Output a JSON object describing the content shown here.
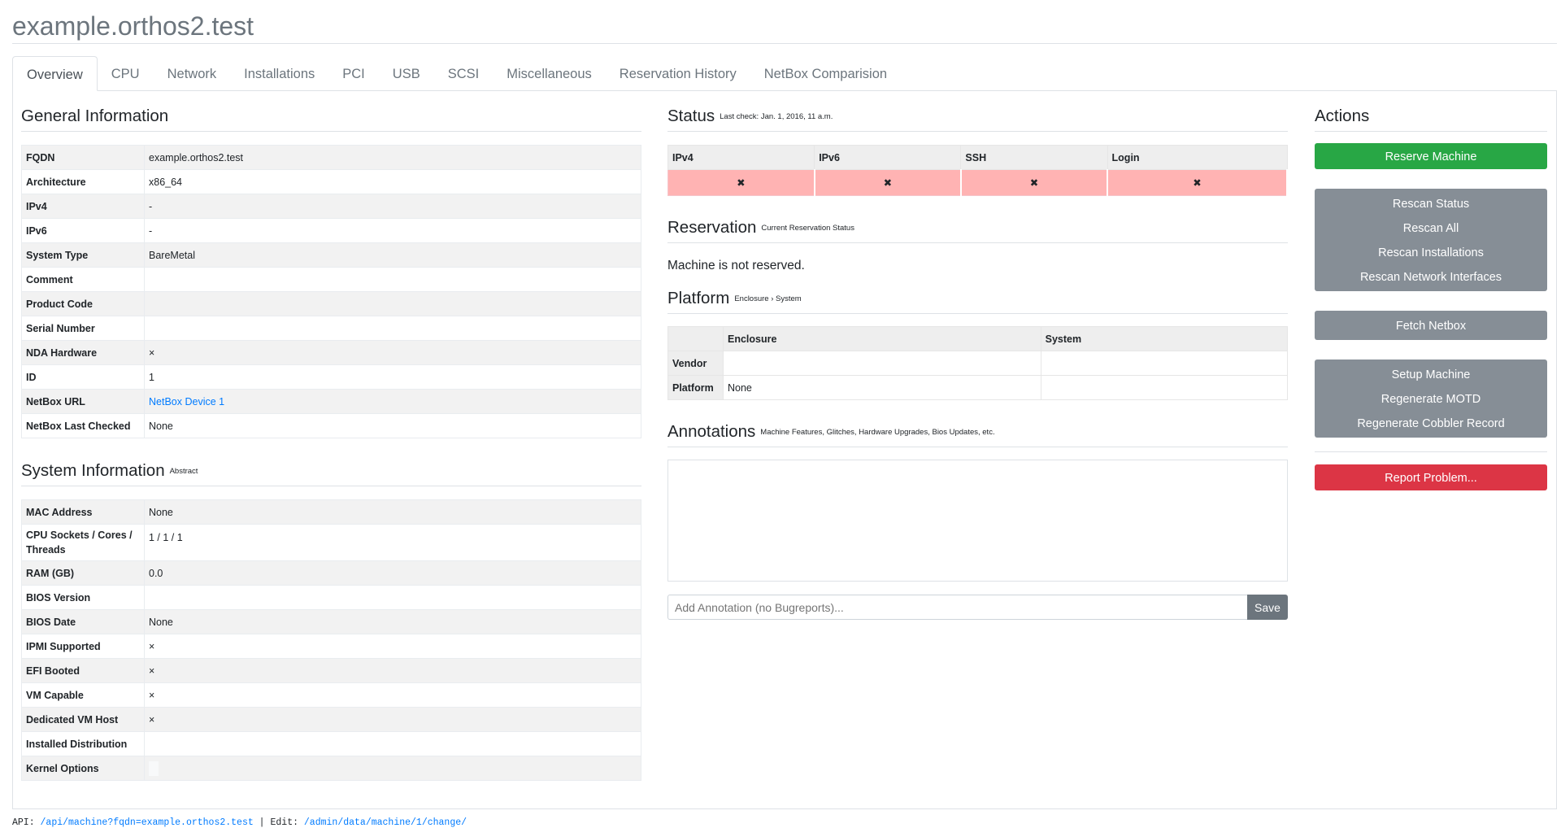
{
  "header": {
    "title": "example.orthos2.test"
  },
  "tabs": [
    {
      "label": "Overview"
    },
    {
      "label": "CPU"
    },
    {
      "label": "Network"
    },
    {
      "label": "Installations"
    },
    {
      "label": "PCI"
    },
    {
      "label": "USB"
    },
    {
      "label": "SCSI"
    },
    {
      "label": "Miscellaneous"
    },
    {
      "label": "Reservation History"
    },
    {
      "label": "NetBox Comparision"
    }
  ],
  "general": {
    "title": "General Information",
    "rows": [
      {
        "k": "FQDN",
        "v": "example.orthos2.test"
      },
      {
        "k": "Architecture",
        "v": "x86_64"
      },
      {
        "k": "IPv4",
        "v": "-"
      },
      {
        "k": "IPv6",
        "v": "-"
      },
      {
        "k": "System Type",
        "v": "BareMetal"
      },
      {
        "k": "Comment",
        "v": ""
      },
      {
        "k": "Product Code",
        "v": ""
      },
      {
        "k": "Serial Number",
        "v": ""
      },
      {
        "k": "NDA Hardware",
        "v": "×"
      },
      {
        "k": "ID",
        "v": "1"
      },
      {
        "k": "NetBox URL",
        "v": "NetBox Device 1"
      },
      {
        "k": "NetBox Last Checked",
        "v": "None"
      }
    ]
  },
  "system": {
    "title": "System Information",
    "subtitle": "Abstract",
    "rows": [
      {
        "k": "MAC Address",
        "v": "None"
      },
      {
        "k": "CPU Sockets / Cores / Threads",
        "v": "1 / 1 / 1"
      },
      {
        "k": "RAM (GB)",
        "v": "0.0"
      },
      {
        "k": "BIOS Version",
        "v": ""
      },
      {
        "k": "BIOS Date",
        "v": "None"
      },
      {
        "k": "IPMI Supported",
        "v": "×"
      },
      {
        "k": "EFI Booted",
        "v": "×"
      },
      {
        "k": "VM Capable",
        "v": "×"
      },
      {
        "k": "Dedicated VM Host",
        "v": "×"
      },
      {
        "k": "Installed Distribution",
        "v": ""
      },
      {
        "k": "Kernel Options",
        "v": ""
      }
    ]
  },
  "status": {
    "title": "Status",
    "subtitle": "Last check: Jan. 1, 2016, 11 a.m.",
    "headers": [
      "IPv4",
      "IPv6",
      "SSH",
      "Login"
    ],
    "values": [
      "✖",
      "✖",
      "✖",
      "✖"
    ],
    "fail_color": "#ffb3b3"
  },
  "reservation": {
    "title": "Reservation",
    "subtitle": "Current Reservation Status",
    "text": "Machine is not reserved."
  },
  "platform": {
    "title": "Platform",
    "subtitle": "Enclosure › System",
    "headers": [
      "",
      "Enclosure",
      "System"
    ],
    "rows": [
      {
        "k": "Vendor",
        "enclosure": "",
        "system": ""
      },
      {
        "k": "Platform",
        "enclosure": "None",
        "system": ""
      }
    ]
  },
  "annotations": {
    "title": "Annotations",
    "subtitle": "Machine Features, Glitches, Hardware Upgrades, Bios Updates, etc.",
    "input_placeholder": "Add Annotation (no Bugreports)...",
    "save_label": "Save"
  },
  "actions": {
    "title": "Actions",
    "reserve": "Reserve Machine",
    "rescan_status": "Rescan Status",
    "rescan_all": "Rescan All",
    "rescan_installations": "Rescan Installations",
    "rescan_network": "Rescan Network Interfaces",
    "fetch_netbox": "Fetch Netbox",
    "setup_machine": "Setup Machine",
    "regenerate_motd": "Regenerate MOTD",
    "regenerate_cobbler": "Regenerate Cobbler Record",
    "report_problem": "Report Problem...",
    "colors": {
      "success": "#28a745",
      "secondary": "#868e96",
      "danger": "#dc3545"
    }
  },
  "footer": {
    "api_label": "API:",
    "api_link": "/api/machine?fqdn=example.orthos2.test",
    "separator": "|",
    "edit_label": "Edit:",
    "edit_link": "/admin/data/machine/1/change/"
  }
}
